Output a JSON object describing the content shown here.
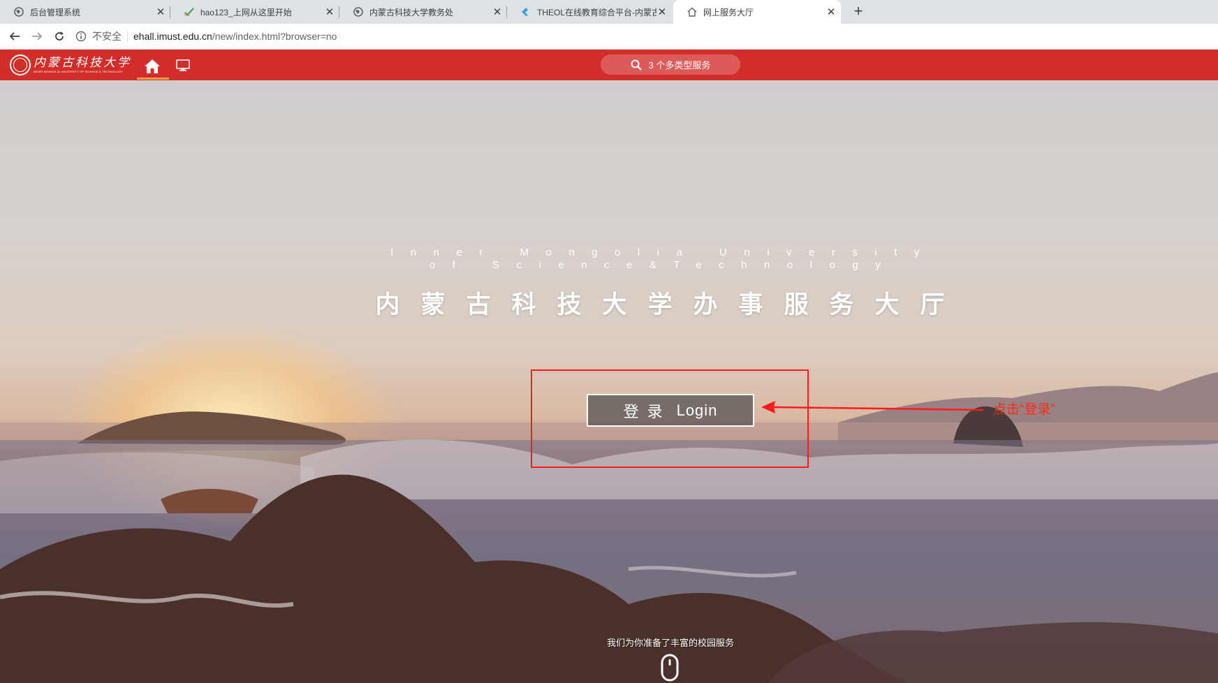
{
  "browser": {
    "tabs": [
      {
        "title": "后台管理系统",
        "icon": "globe-icon",
        "active": false
      },
      {
        "title": "hao123_上网从这里开始",
        "icon": "hao123-icon",
        "active": false
      },
      {
        "title": "内蒙古科技大学教务处",
        "icon": "globe-icon",
        "active": false
      },
      {
        "title": "THEOL在线教育综合平台-内蒙古",
        "icon": "theol-icon",
        "active": false
      },
      {
        "title": "网上服务大厅",
        "icon": "home-outline-icon",
        "active": true
      }
    ],
    "new_tab_label": "+",
    "close_label": "✕",
    "address": {
      "security_label": "不安全",
      "host": "ehall.imust.edu.cn",
      "path": "/new/index.html?browser=no"
    }
  },
  "header": {
    "logo": {
      "cn": "内蒙古科技大学",
      "en": "INNER MONGOLIA UNIVERSITY OF SCIENCE & TECHNOLOGY"
    },
    "search_label": "3 个多类型服务",
    "accent_color": "#d32d2a"
  },
  "hero": {
    "title": "内蒙古科技大学办事服务大厅",
    "subtitle": "Inner Mongolia University of Science&Technology",
    "login_cn": "登录",
    "login_en": "Login",
    "tagline": "我们为你准备了丰富的校园服务"
  },
  "annotation": {
    "text": "点击“登录”",
    "color": "#ff1a1a"
  }
}
